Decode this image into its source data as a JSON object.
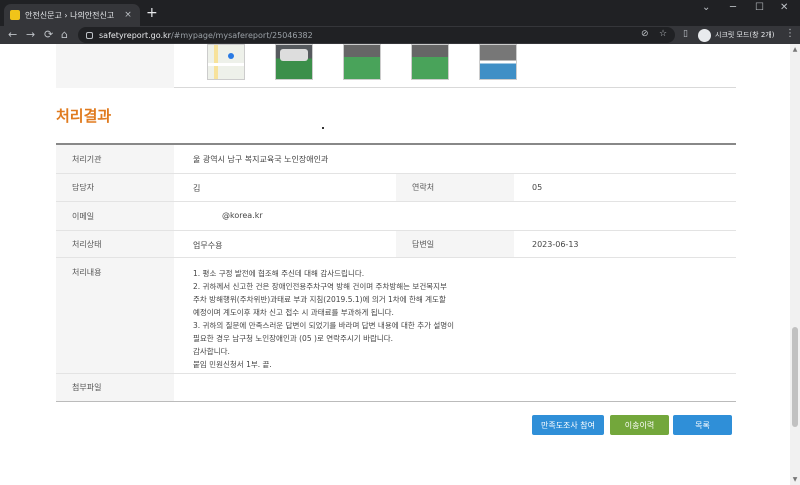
{
  "browser": {
    "tab_title": "안전신문고 › 나의안전신고",
    "tab_close": "×",
    "new_tab": "+",
    "url_host": "safetyreport.go.kr",
    "url_path": "/#mypage/mysafereport/25046382",
    "profile_label": "시크릿 모드(창 2개)",
    "win_min": "─",
    "win_max": "☐",
    "win_close": "✕",
    "menu": "⋮",
    "back": "←",
    "forward": "→",
    "reload": "⟳",
    "home": "⌂",
    "omni_eye": "⊘",
    "omni_star": "☆",
    "sidepanel": "▯",
    "chevron": "⌄"
  },
  "section": {
    "title": "처리결과"
  },
  "table": {
    "agency_label": "처리기관",
    "agency_value": "울  광역시 남구 복지교육국 노인장애인과",
    "manager_label": "담당자",
    "manager_value": "김",
    "contact_label": "연락처",
    "contact_value": "05",
    "email_label": "이메일",
    "email_value": "@korea.kr",
    "status_label": "처리상태",
    "status_value": "업무수용",
    "reply_date_label": "답변일",
    "reply_date_value": "2023-06-13",
    "content_label": "처리내용",
    "content_lines": [
      "1. 평소 구정 발전에 협조해 주신데 대해 감사드립니다.",
      "2. 귀하께서 신고한 건은 장애인전용주차구역 방해 건이며 주차방해는 보건복지부",
      "주차 방해행위(주차위반)과태료 부과 지침(2019.5.1)에 의거 1차에 한해 계도할",
      "예정이며 계도이후 재차 신고 접수 시 과태료를 부과하게 됩니다.",
      "3. 귀하의 질문에 만족스러운 답변이 되었기를 바라며 답변 내용에 대한 추가 설명이",
      "필요한 경우 남구청 노인장애인과 (05               )로 연락주시기 바랍니다.",
      "감사합니다.",
      "붙임 민원신청서 1부. 끝."
    ],
    "attachment_label": "첨부파일",
    "attachment_value": ""
  },
  "buttons": {
    "survey": "만족도조사 참여",
    "transfer_history": "이송이력",
    "list": "목록"
  },
  "colors": {
    "accent_orange": "#e07b1f",
    "button_blue": "#2f8fd8",
    "button_green": "#73a73b"
  }
}
